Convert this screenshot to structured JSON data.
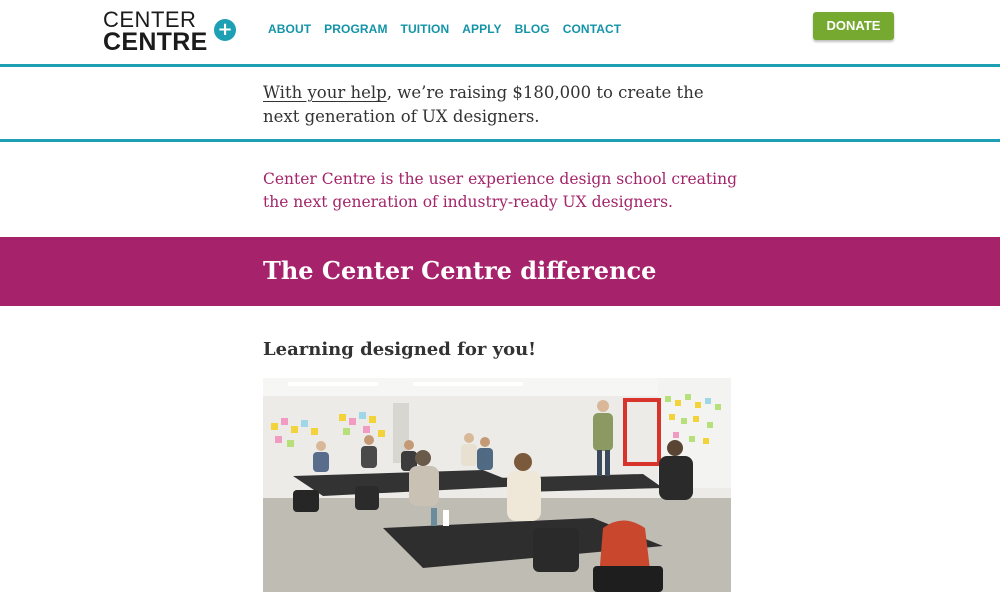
{
  "logo": {
    "line1": "CENTER",
    "line2": "CENTRE",
    "plus_glyph": "+"
  },
  "nav": {
    "items": [
      {
        "label": "ABOUT"
      },
      {
        "label": "PROGRAM"
      },
      {
        "label": "TUITION"
      },
      {
        "label": "APPLY"
      },
      {
        "label": "BLOG"
      },
      {
        "label": "CONTACT"
      }
    ]
  },
  "donate": {
    "label": "DONATE"
  },
  "fundraising": {
    "link_text": "With your help",
    "rest_text": ", we’re raising $180,000 to create the next generation of UX designers."
  },
  "intro": {
    "text": "Center Centre is the user experience design school creating the next generation of industry-ready UX designers."
  },
  "band": {
    "title": "The Center Centre difference"
  },
  "section": {
    "heading": "Learning designed for you!"
  },
  "colors": {
    "teal": "#1ea0b4",
    "nav_teal": "#1494a8",
    "magenta": "#a6236c",
    "donate_green": "#76a92f",
    "text": "#333333"
  }
}
